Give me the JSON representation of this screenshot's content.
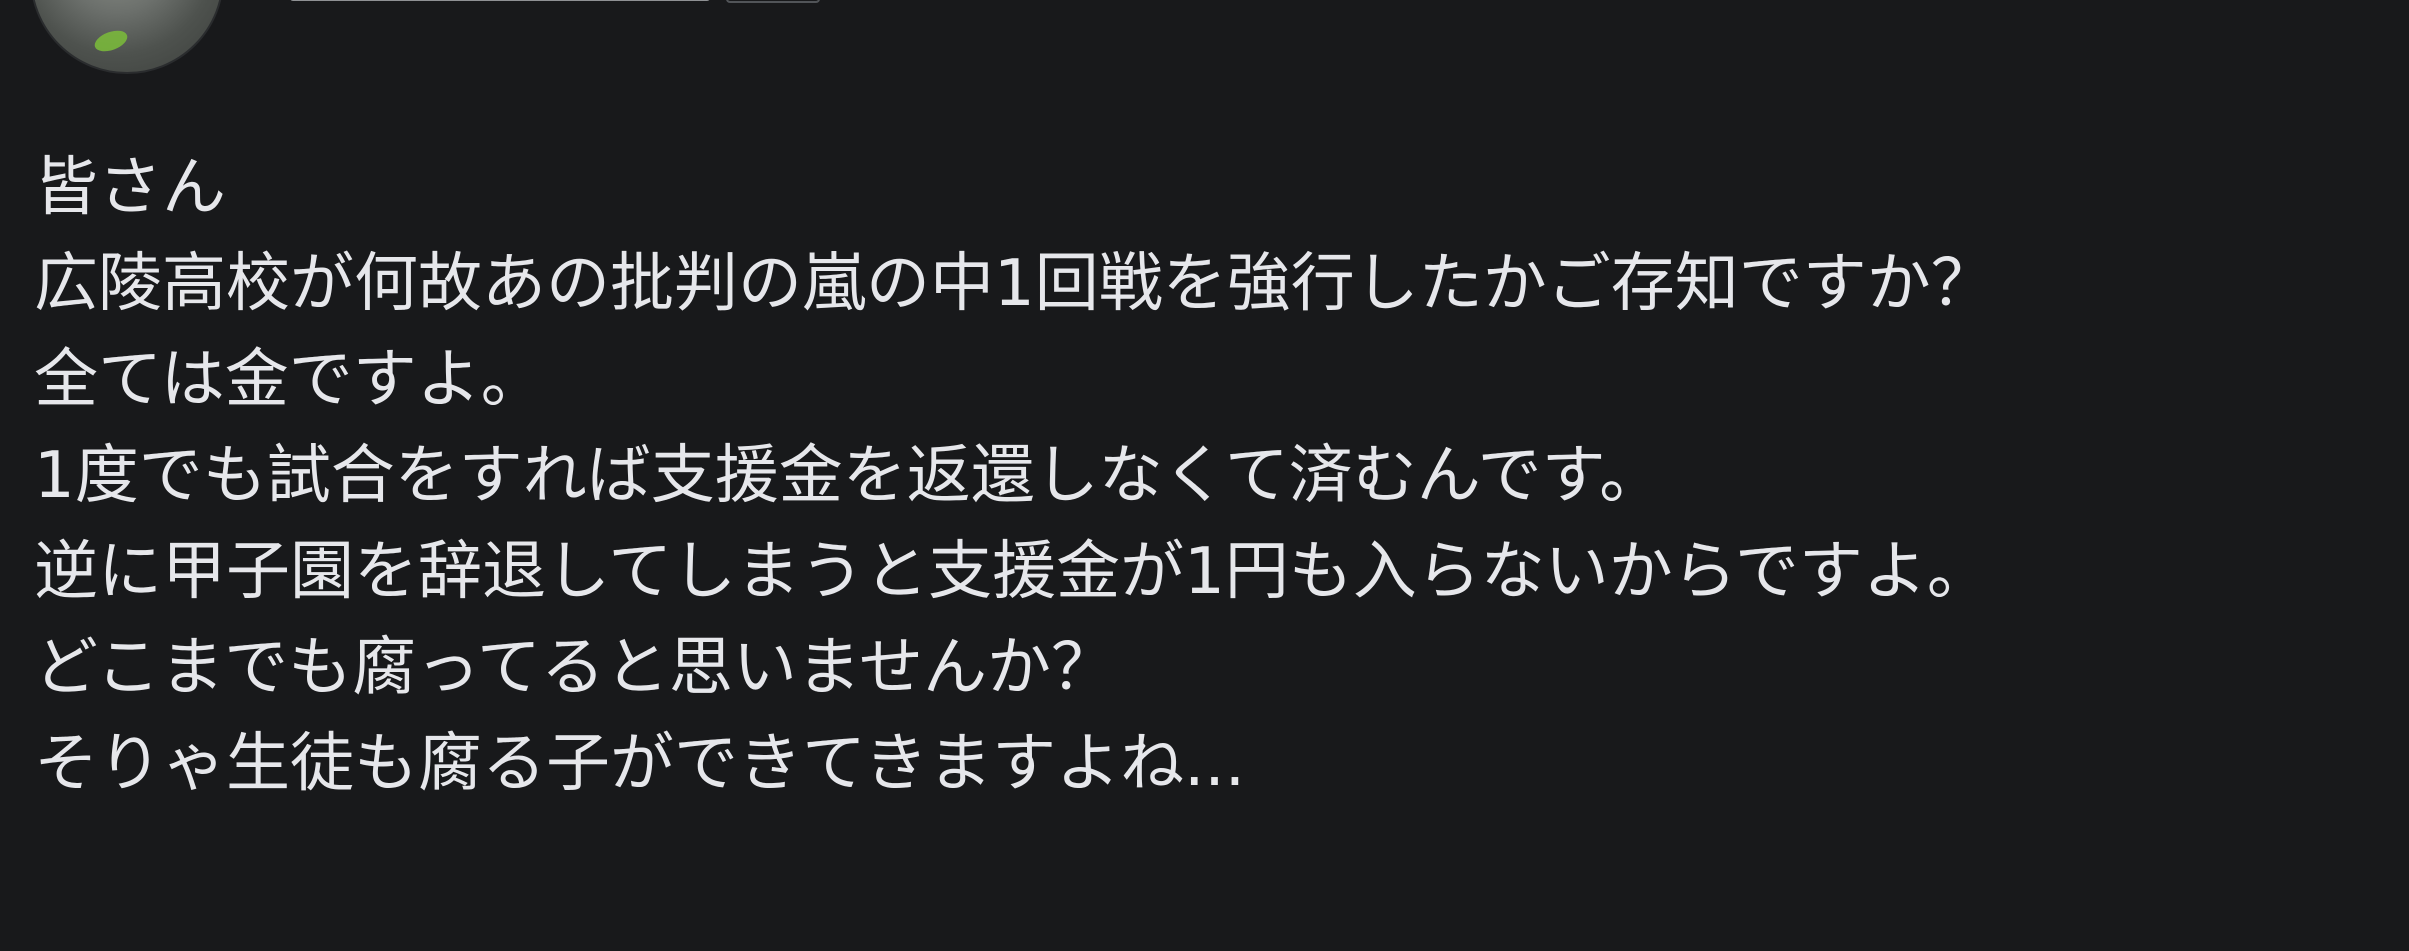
{
  "post": {
    "author_name": "",
    "lines": [
      "皆さん",
      "広陵高校が何故あの批判の嵐の中1回戦を強行したかご存知ですか？",
      "全ては金ですよ。",
      "1度でも試合をすれば支援金を返還しなくて済むんです。",
      "逆に甲子園を辞退してしまうと支援金が1円も入らないからですよ。",
      "どこまでも腐ってると思いませんか？",
      "そりゃ生徒も腐る子ができてきますよね..."
    ]
  },
  "colors": {
    "background": "#18191b",
    "text": "#e6e7eb"
  }
}
